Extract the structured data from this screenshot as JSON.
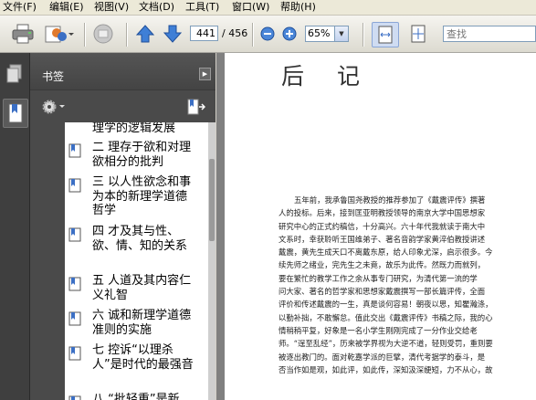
{
  "menu": [
    {
      "label": "文件(F)"
    },
    {
      "label": "编辑(E)"
    },
    {
      "label": "视图(V)"
    },
    {
      "label": "文档(D)"
    },
    {
      "label": "工具(T)"
    },
    {
      "label": "窗口(W)"
    },
    {
      "label": "帮助(H)"
    }
  ],
  "toolbar": {
    "current_page": "441",
    "page_total": "/ 456",
    "zoom": "65%",
    "search_placeholder": "查找"
  },
  "bookmarks": {
    "title": "书签",
    "items": [
      {
        "label": "理学的逻辑发展"
      },
      {
        "label": "二 理存于欲和对理欲相分的批判"
      },
      {
        "label": "三 以人性欲念和事为本的新理学道德哲学"
      },
      {
        "label": "四 才及其与性、欲、情、知的关系"
      },
      {
        "label": "五 人道及其内容仁义礼智"
      },
      {
        "label": "六 诚和新理学道德准则的实施"
      },
      {
        "label": "七 控诉“以理杀人”是时代的最强音"
      },
      {
        "label": "八 “批轻重”是新"
      }
    ]
  },
  "document": {
    "title": "后 记",
    "lines": [
      "五年前，我承鲁国尧教授的推荐参加了《戴震评传》撰著",
      "人的投标。后来，接到匡亚明教授领导的南京大学中国思想家",
      "研究中心的正式约稿信，十分高兴。六十年代我就读于南大中",
      "文系时，幸获聆听王国维弟子、著名音韵学家黄淬伯教授讲述",
      "戴震，黄先生成天口不离戴东原，给人印象尤深，启示很多。今",
      "续先师之绪业，完先生之未竟，故乐为此传。然既力而就列，",
      "要在繁忙的教学工作之余从事专门研究，为清代第一流的学",
      "问大家、著名的哲学家和思想家戴震撰写一部长篇评传，全面",
      "评价和传述戴震的一生，真是谈何容易！朝夜以思，知瞿瀚涤，",
      "以勤补拙，不敢懈怠。值此交出《戴震评传》书稿之际，我的心",
      "情稍稍平复，好象是一名小学生刚刚完成了一分作业交给老",
      "师。“逞至乱经”，历来被学界视为大逆不道，轻则受罚，重则要",
      "被逐出教门的。面对乾嘉学派的巨擘，清代考据学的泰斗，是",
      "否当作如是观，如此评，如此传，深知汲深绠短，力不从心，故"
    ]
  }
}
